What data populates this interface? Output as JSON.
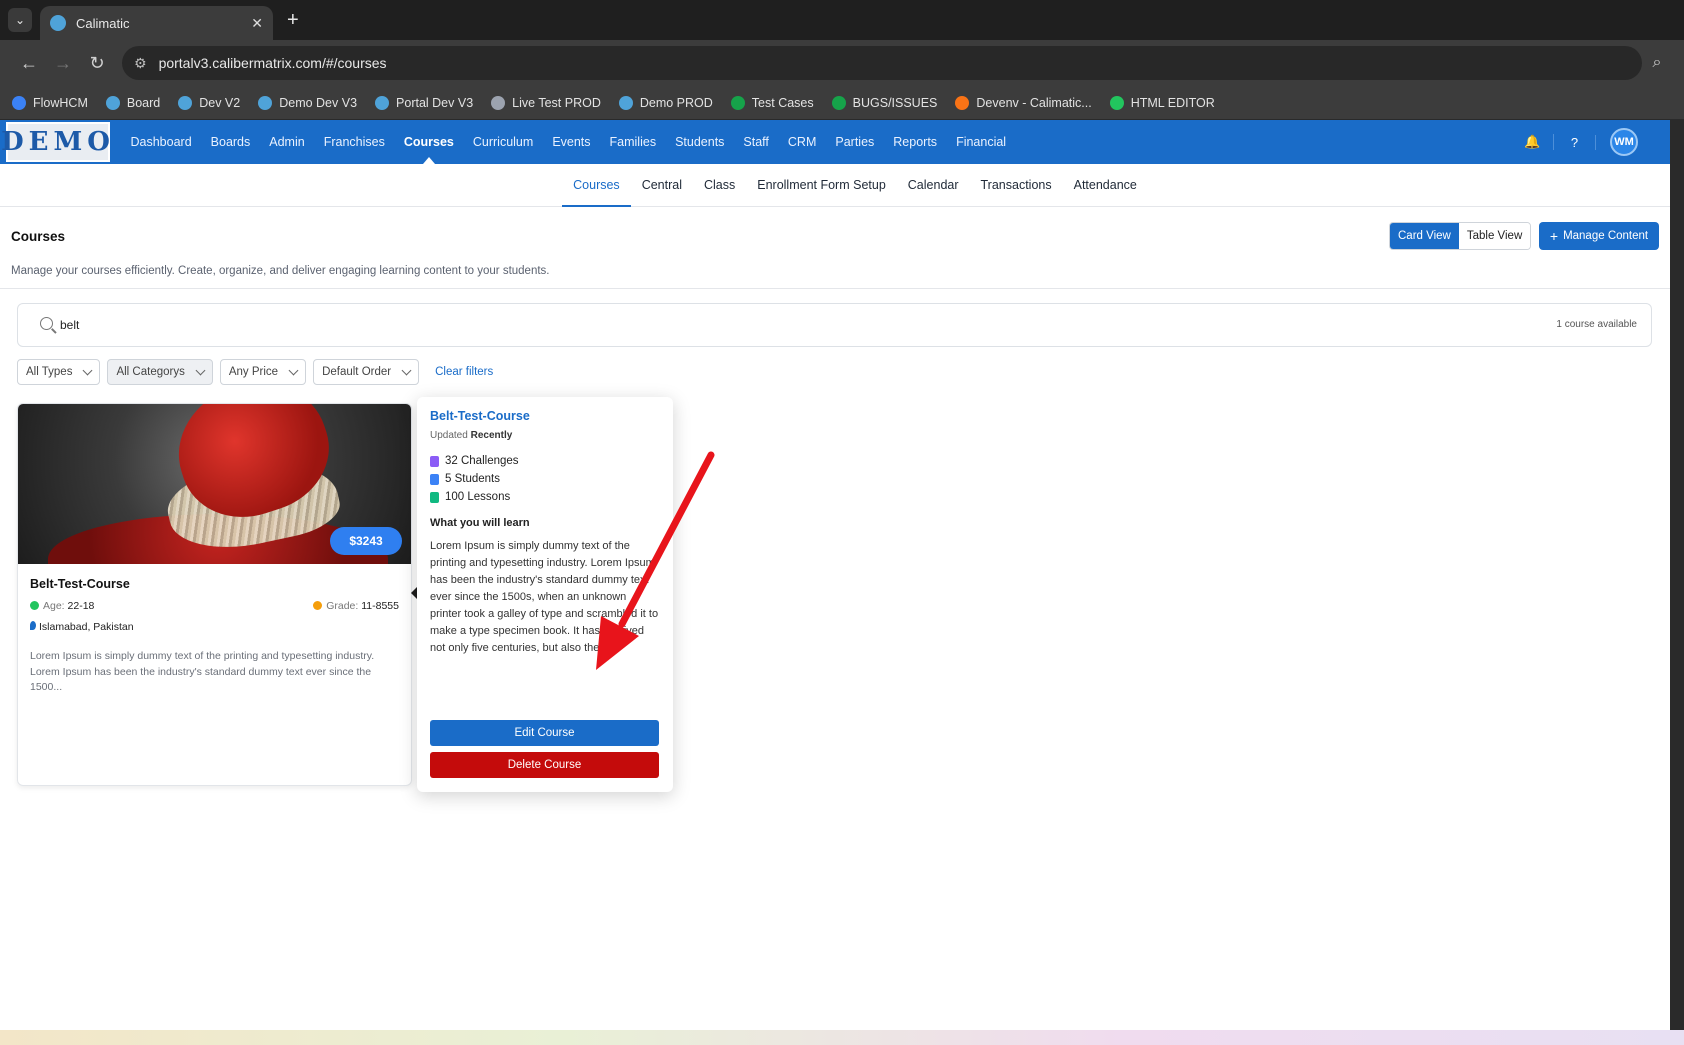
{
  "browser": {
    "tab_title": "Calimatic",
    "tab_close": "✕",
    "new_tab": "+",
    "tab_menu": "⌄",
    "url": "portalv3.calibermatrix.com/#/courses",
    "bookmarks": [
      {
        "label": "FlowHCM",
        "color": "#3b82f6"
      },
      {
        "label": "Board",
        "color": "#4fa3d9"
      },
      {
        "label": "Dev V2",
        "color": "#4fa3d9"
      },
      {
        "label": "Demo Dev V3",
        "color": "#4fa3d9"
      },
      {
        "label": "Portal Dev V3",
        "color": "#4fa3d9"
      },
      {
        "label": "Live Test PROD",
        "color": "#9ca3af"
      },
      {
        "label": "Demo PROD",
        "color": "#4fa3d9"
      },
      {
        "label": "Test Cases",
        "color": "#16a34a"
      },
      {
        "label": "BUGS/ISSUES",
        "color": "#16a34a"
      },
      {
        "label": "Devenv - Calimatic...",
        "color": "#f97316"
      },
      {
        "label": "HTML EDITOR",
        "color": "#22c55e"
      }
    ]
  },
  "app": {
    "logo": "DEMO",
    "menu": [
      "Dashboard",
      "Boards",
      "Admin",
      "Franchises",
      "Courses",
      "Curriculum",
      "Events",
      "Families",
      "Students",
      "Staff",
      "CRM",
      "Parties",
      "Reports",
      "Financial"
    ],
    "active_menu": "Courses",
    "user_initials": "WM",
    "subnav": [
      "Courses",
      "Central",
      "Class",
      "Enrollment Form Setup",
      "Calendar",
      "Transactions",
      "Attendance"
    ],
    "active_subnav": "Courses"
  },
  "page": {
    "title": "Courses",
    "subtitle": "Manage your courses efficiently. Create, organize, and deliver engaging learning content to your students.",
    "card_view": "Card View",
    "table_view": "Table View",
    "manage_content": "Manage Content",
    "search_value": "belt",
    "course_count": "1 course available",
    "filters": [
      "All Types",
      "All Categorys",
      "Any Price",
      "Default Order"
    ],
    "clear_filters": "Clear filters"
  },
  "course": {
    "title": "Belt-Test-Course",
    "price": "$3243",
    "age_label": "Age:",
    "age": "22-18",
    "grade_label": "Grade:",
    "grade": "11-8555",
    "location": "Islamabad, Pakistan",
    "short_desc": "Lorem Ipsum is simply dummy text of the printing and typesetting industry. Lorem Ipsum has been the industry's standard dummy text ever since the 1500...",
    "colors": {
      "age_dot": "#22c55e",
      "grade_dot": "#f59e0b"
    }
  },
  "popover": {
    "title": "Belt-Test-Course",
    "updated_label": "Updated",
    "updated_value": "Recently",
    "stats": [
      {
        "label": "32 Challenges",
        "icon": "clipboard-icon",
        "color": "#8b5cf6"
      },
      {
        "label": "5 Students",
        "icon": "users-icon",
        "color": "#3b82f6"
      },
      {
        "label": "100 Lessons",
        "icon": "book-icon",
        "color": "#10b981"
      }
    ],
    "learn_heading": "What you will learn",
    "learn_text": "Lorem Ipsum is simply dummy text of the printing and typesetting industry. Lorem Ipsum has been the industry's standard dummy text ever since the 1500s, when an unknown printer took a galley of type and scrambled it to make a type specimen book. It has survived not only five centuries, but also the ...",
    "edit_button": "Edit Course",
    "delete_button": "Delete Course"
  },
  "annotation": {
    "arrow_color": "#e8141b"
  }
}
